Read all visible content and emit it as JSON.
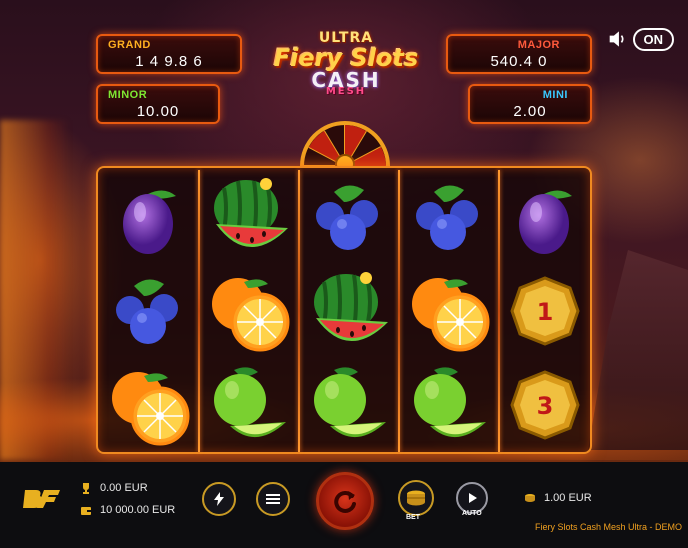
{
  "jackpots": {
    "grand": {
      "label": "GRAND",
      "value": "1 4 9.8 6"
    },
    "minor": {
      "label": "MINOR",
      "value": "10.00"
    },
    "major": {
      "label": "MAJOR",
      "value": "540.4 0"
    },
    "mini": {
      "label": "MINI",
      "value": "2.00"
    }
  },
  "logo": {
    "line1": "ULTRA",
    "line2": "Fiery Slots",
    "line3": "CASH",
    "line4": "MESH"
  },
  "sound": {
    "icon": "speaker-icon",
    "label": "ON"
  },
  "reels": [
    [
      "plum",
      "blueberries",
      "orange"
    ],
    [
      "watermelon",
      "orange",
      "lime"
    ],
    [
      "blueberries",
      "watermelon",
      "lime"
    ],
    [
      "blueberries",
      "orange",
      "lime"
    ],
    [
      "plum",
      "coin-1",
      "coin-3"
    ]
  ],
  "coins": {
    "coin-1": "1",
    "coin-3": "3"
  },
  "status": {
    "win": {
      "icon": "trophy-icon",
      "value": "0.00 EUR"
    },
    "balance": {
      "icon": "wallet-icon",
      "value": "10 000.00 EUR"
    },
    "bet": {
      "icon": "coins-icon",
      "value": "1.00 EUR"
    }
  },
  "controls": {
    "bet_label": "BET",
    "auto_label": "AUTO"
  },
  "footer": {
    "game_title": "Fiery Slots Cash Mesh Ultra - DEMO"
  },
  "colors": {
    "accent": "#e85a10",
    "grand": "#ffb020",
    "minor": "#7ee832",
    "major": "#ff5a3c",
    "mini": "#3ac8ff"
  }
}
